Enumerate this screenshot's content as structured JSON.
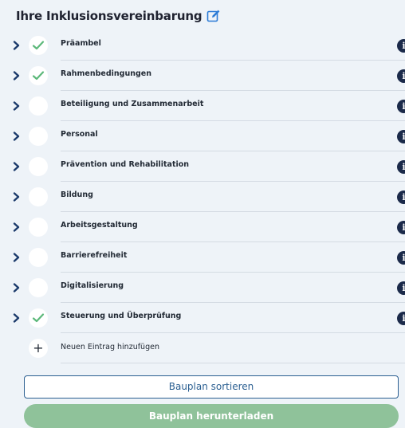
{
  "header": {
    "title": "Ihre Inklusionsvereinbarung",
    "edit_icon": "edit-pencil-icon"
  },
  "colors": {
    "panel_bg": "#eef3f8",
    "check_green": "#5cb87a",
    "chevron_navy": "#1b3a6b",
    "info_navy": "#1b2a4a",
    "sort_border": "#2b5f91",
    "download_green": "#8fc29a"
  },
  "sections": [
    {
      "label": "Präambel",
      "completed": true
    },
    {
      "label": "Rahmenbedingungen",
      "completed": true
    },
    {
      "label": "Beteiligung und Zusammenarbeit",
      "completed": false
    },
    {
      "label": "Personal",
      "completed": false
    },
    {
      "label": "Prävention und Rehabilitation",
      "completed": false
    },
    {
      "label": "Bildung",
      "completed": false
    },
    {
      "label": "Arbeitsgestaltung",
      "completed": false
    },
    {
      "label": "Barrierefreiheit",
      "completed": false
    },
    {
      "label": "Digitalisierung",
      "completed": false
    },
    {
      "label": "Steuerung und Überprüfung",
      "completed": true
    }
  ],
  "info_glyph": "i",
  "add_entry": {
    "icon_glyph": "+",
    "label": "Neuen Eintrag hinzufügen"
  },
  "buttons": {
    "sort_label": "Bauplan sortieren",
    "download_label": "Bauplan herunterladen"
  }
}
